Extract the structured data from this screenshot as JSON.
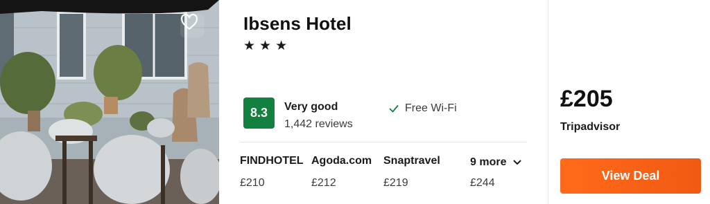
{
  "hotel": {
    "name": "Ibsens Hotel",
    "stars": "★★★",
    "rating": {
      "score": "8.3",
      "label": "Very good",
      "reviews": "1,442 reviews",
      "color": "#12803e"
    },
    "amenity": {
      "icon": "check-icon",
      "label": "Free Wi-Fi"
    }
  },
  "providers": [
    {
      "name": "FINDHOTEL",
      "price": "£210"
    },
    {
      "name": "Agoda.com",
      "price": "£212"
    },
    {
      "name": "Snaptravel",
      "price": "£219"
    }
  ],
  "more_offers": {
    "label": "9 more",
    "price": "£244",
    "icon": "chevron-down-icon"
  },
  "best_deal": {
    "price": "£205",
    "source": "Tripadvisor",
    "button_label": "View Deal",
    "button_color": "#f7631a"
  },
  "favorite": {
    "icon": "heart-icon"
  }
}
